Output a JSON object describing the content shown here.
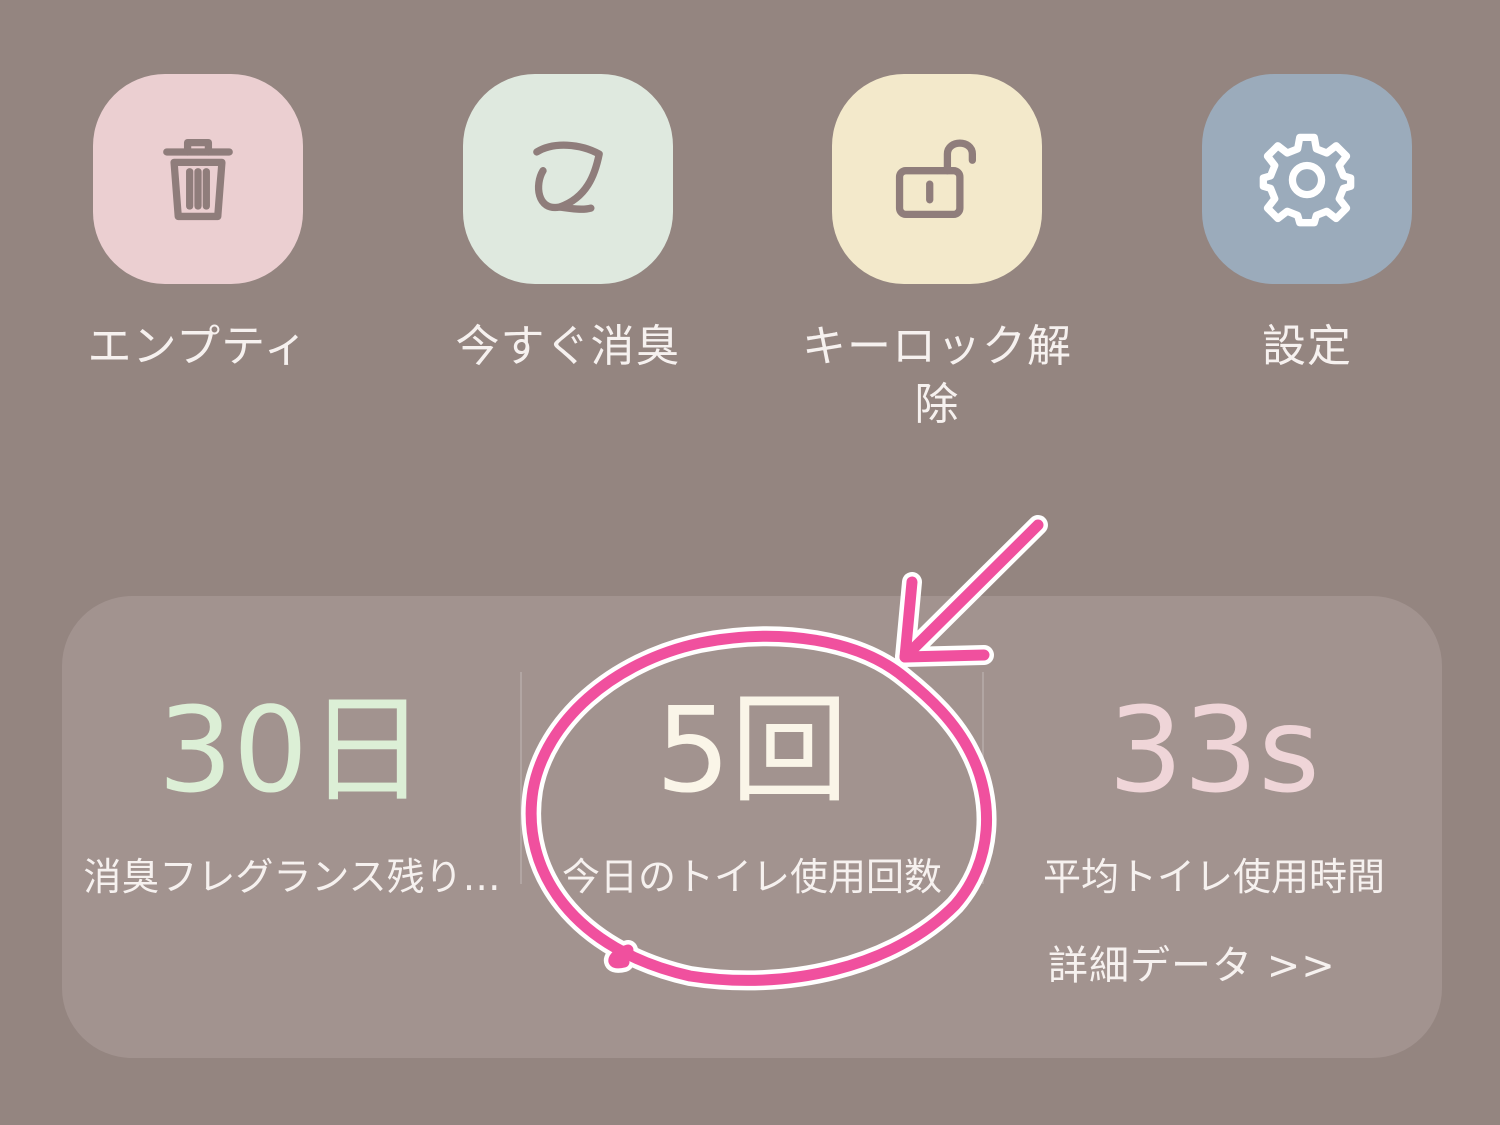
{
  "actions": [
    {
      "label": "エンプティ",
      "icon": "trash-icon",
      "color": "#ebcfd1"
    },
    {
      "label": "今すぐ消臭",
      "icon": "leaf-icon",
      "color": "#dfe9df"
    },
    {
      "label": "キーロック解除",
      "icon": "unlock-icon",
      "color": "#f3e9cb"
    },
    {
      "label": "設定",
      "icon": "gear-icon",
      "color": "#9babbb"
    }
  ],
  "stats": [
    {
      "value": "30日",
      "label": "消臭フレグランス残り…",
      "color": "#dcefd6"
    },
    {
      "value": "5回",
      "label": "今日のトイレ使用回数",
      "color": "#faf5e8"
    },
    {
      "value": "33s",
      "label": "平均トイレ使用時間",
      "color": "#efd5d8"
    }
  ],
  "detail_link": "詳細データ >>",
  "colors": {
    "background": "#948580",
    "card": "#a2938f",
    "icon_stroke": "#8f7d7b",
    "annotation": "#f0509e"
  }
}
